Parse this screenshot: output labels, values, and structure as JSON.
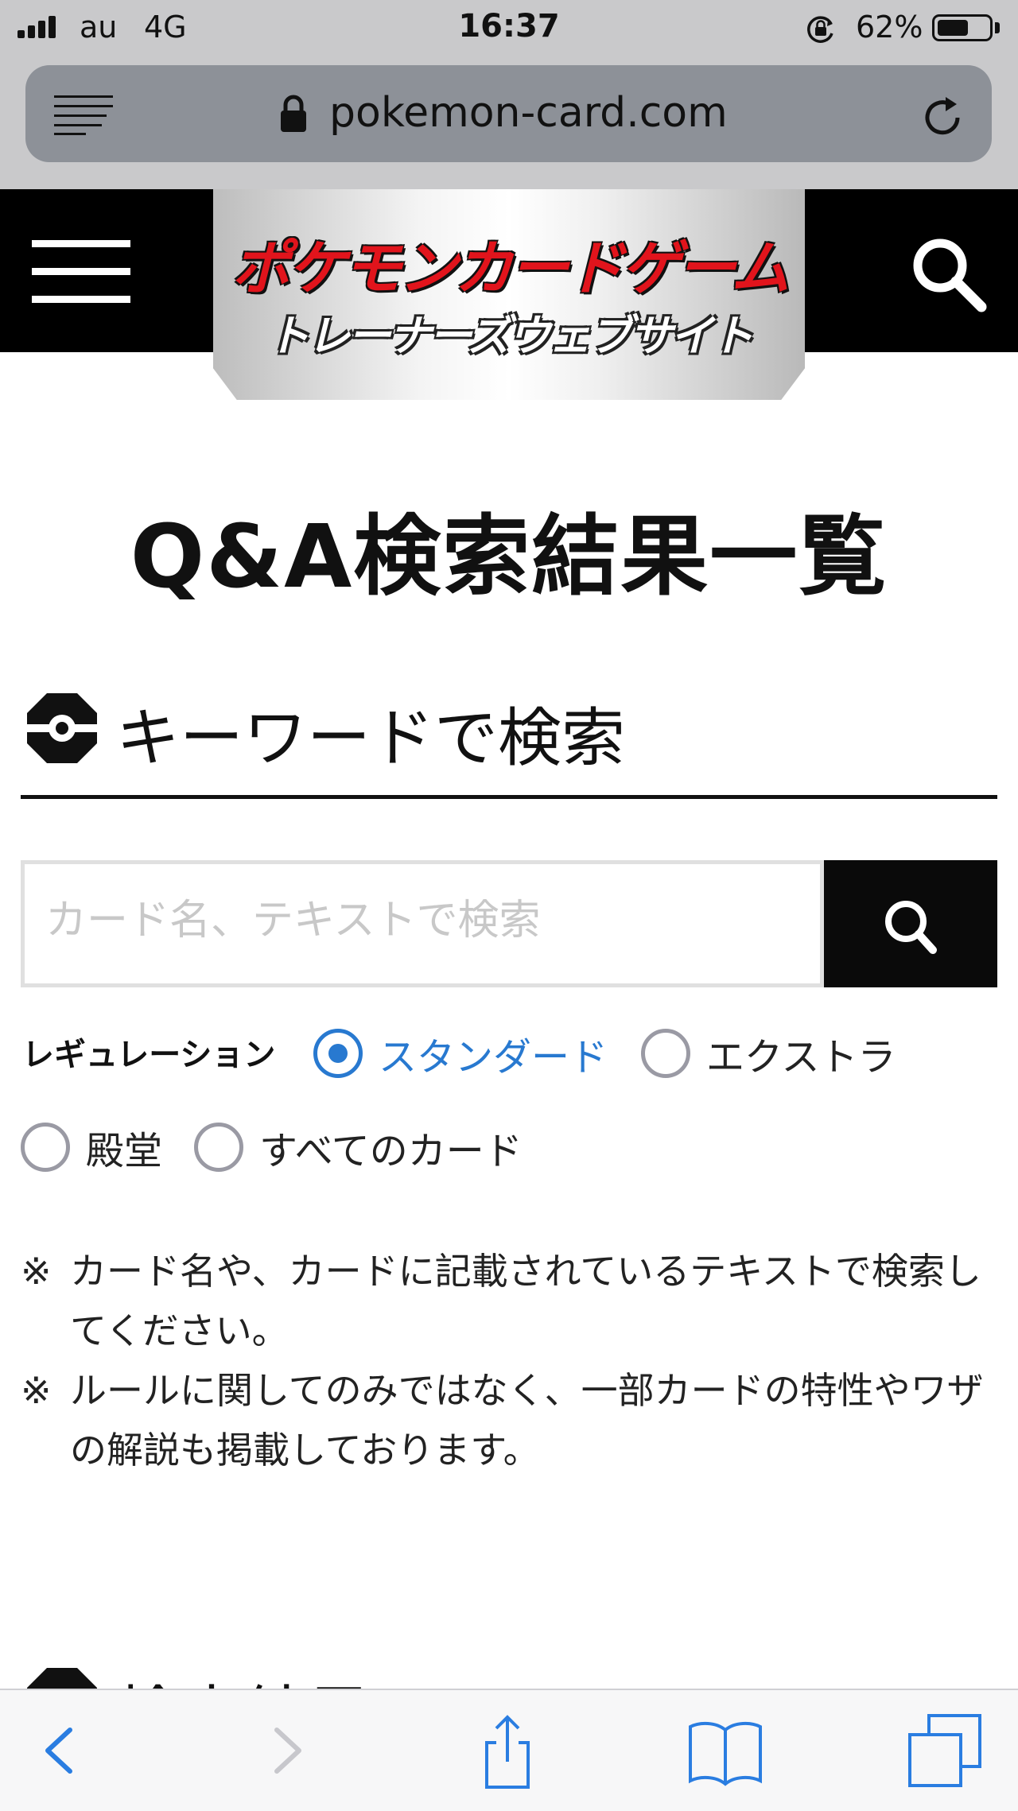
{
  "status_bar": {
    "carrier": "au",
    "network": "4G",
    "time": "16:37",
    "battery_percent_label": "62%",
    "battery_level": 0.62,
    "icons": [
      "signal-icon",
      "orientation-lock-icon",
      "battery-icon"
    ]
  },
  "browser": {
    "url": "pokemon-card.com",
    "icons": [
      "reader-view-icon",
      "lock-icon",
      "reload-icon"
    ]
  },
  "site_header": {
    "logo_line1": "ポケモンカードゲーム",
    "logo_line2": "トレーナーズウェブサイト",
    "logo_colors": {
      "red": "#e1141c",
      "outline": "#111111"
    },
    "icons": [
      "menu-icon",
      "search-icon"
    ]
  },
  "page": {
    "title": "Q&A検索結果一覧",
    "keyword_section": {
      "title": "キーワードで検索",
      "icon": "pokeball-icon",
      "search_placeholder": "カード名、テキストで検索",
      "search_value": ""
    },
    "regulation": {
      "label": "レギュレーション",
      "options": [
        {
          "label": "スタンダード",
          "checked": true
        },
        {
          "label": "エクストラ",
          "checked": false
        },
        {
          "label": "殿堂",
          "checked": false
        },
        {
          "label": "すべてのカード",
          "checked": false
        }
      ],
      "accent_color": "#2879d0"
    },
    "notes": [
      {
        "mark": "※",
        "text": "カード名や、カードに記載されているテキストで検索してください。"
      },
      {
        "mark": "※",
        "text": "ルールに関してのみではなく、一部カードの特性やワザの解説も掲載しております。"
      }
    ],
    "results_section": {
      "title": "検索結果",
      "icon": "pokeball-icon"
    }
  },
  "toolbar": {
    "icons": [
      "back-icon",
      "forward-icon",
      "share-icon",
      "bookmarks-icon",
      "tabs-icon"
    ]
  }
}
